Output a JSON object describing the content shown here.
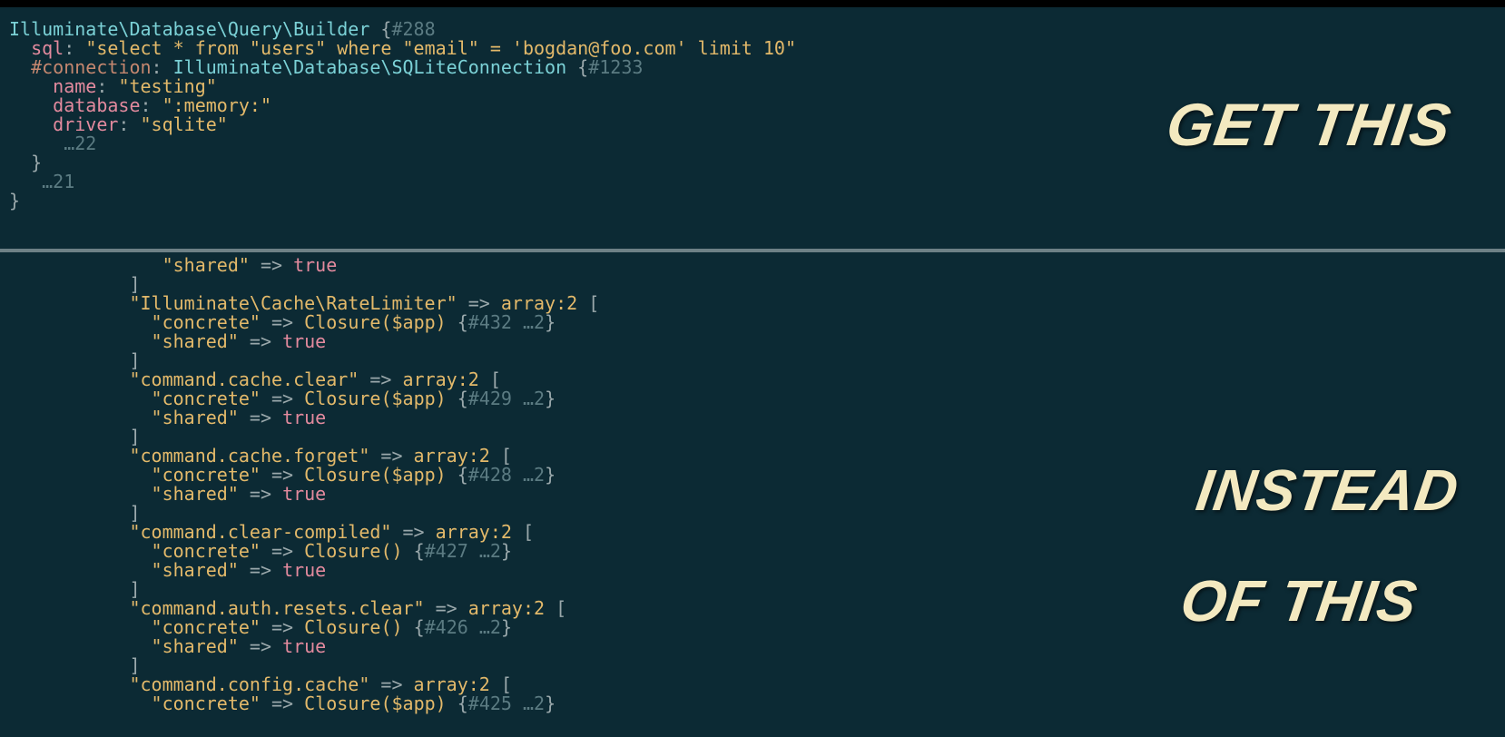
{
  "captions": {
    "top": "GET THIS",
    "bottom_l1": "INSTEAD",
    "bottom_l2": "OF THIS"
  },
  "top": {
    "class_name": "Illuminate\\Database\\Query\\Builder",
    "class_id": "#288",
    "sql_label": "sql",
    "sql_value": "\"select * from \"users\" where \"email\" = 'bogdan@foo.com' limit 10\"",
    "conn_hash_label": "#connection",
    "conn_class": "Illuminate\\Database\\SQLiteConnection",
    "conn_id": "#1233",
    "name_key": "name",
    "name_val": "\"testing\"",
    "db_key": "database",
    "db_val": "\":memory:\"",
    "driver_key": "driver",
    "driver_val": "\"sqlite\"",
    "ellipsis_inner": "…22",
    "ellipsis_outer": "…21"
  },
  "bottom": {
    "line0_key": "\"shared\"",
    "line0_val": "true",
    "entries": [
      {
        "key": "\"Illuminate\\Cache\\RateLimiter\"",
        "array": "array:2",
        "concrete_args": "Closure($app)",
        "id": "#432",
        "ellip": "…2",
        "shared": "true"
      },
      {
        "key": "\"command.cache.clear\"",
        "array": "array:2",
        "concrete_args": "Closure($app)",
        "id": "#429",
        "ellip": "…2",
        "shared": "true"
      },
      {
        "key": "\"command.cache.forget\"",
        "array": "array:2",
        "concrete_args": "Closure($app)",
        "id": "#428",
        "ellip": "…2",
        "shared": "true"
      },
      {
        "key": "\"command.clear-compiled\"",
        "array": "array:2",
        "concrete_args": "Closure()",
        "id": "#427",
        "ellip": "…2",
        "shared": "true"
      },
      {
        "key": "\"command.auth.resets.clear\"",
        "array": "array:2",
        "concrete_args": "Closure()",
        "id": "#426",
        "ellip": "…2",
        "shared": "true"
      },
      {
        "key": "\"command.config.cache\"",
        "array": "array:2",
        "concrete_args": "Closure($app)",
        "id": "#425",
        "ellip": "…2",
        "shared": "true"
      }
    ],
    "concrete_label": "\"concrete\"",
    "shared_label": "\"shared\""
  }
}
